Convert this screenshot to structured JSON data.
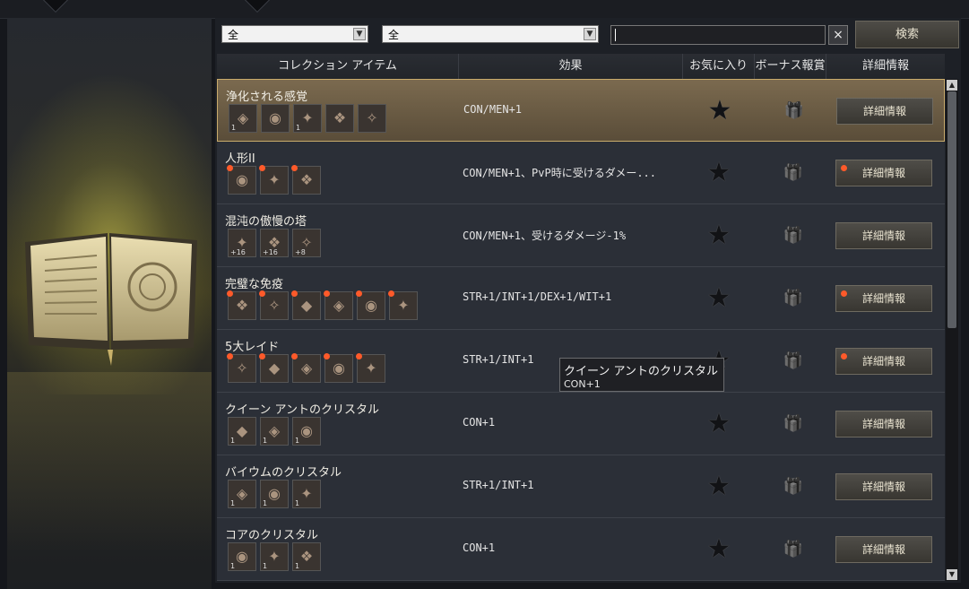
{
  "filters": {
    "filter1_value": "全",
    "filter2_value": "全",
    "search_value": "",
    "clear_symbol": "×",
    "search_button_label": "検索"
  },
  "table": {
    "headers": {
      "item": "コレクション アイテム",
      "effect": "効果",
      "favorite": "お気に入り",
      "bonus": "ボーナス報賞",
      "details": "詳細情報"
    },
    "rows": [
      {
        "name": "浄化される感覚",
        "effect": "CON/MEN+1",
        "detail_label": "詳細情報",
        "selected": true,
        "detail_alert": false,
        "items": [
          {
            "count": "1",
            "alert": false
          },
          {
            "count": "",
            "alert": false
          },
          {
            "count": "1",
            "alert": false
          },
          {
            "count": "",
            "alert": false
          },
          {
            "count": "",
            "alert": false
          }
        ]
      },
      {
        "name": "人形II",
        "effect": "CON/MEN+1、PvP時に受けるダメー...",
        "detail_label": "詳細情報",
        "selected": false,
        "detail_alert": true,
        "items": [
          {
            "count": "",
            "alert": true
          },
          {
            "count": "",
            "alert": true
          },
          {
            "count": "",
            "alert": true
          }
        ]
      },
      {
        "name": "混沌の傲慢の塔",
        "effect": "CON/MEN+1、受けるダメージ-1%",
        "detail_label": "詳細情報",
        "selected": false,
        "detail_alert": false,
        "items": [
          {
            "count": "+16",
            "alert": false
          },
          {
            "count": "+16",
            "alert": false
          },
          {
            "count": "+8",
            "alert": false
          }
        ]
      },
      {
        "name": "完璧な免疫",
        "effect": "STR+1/INT+1/DEX+1/WIT+1",
        "detail_label": "詳細情報",
        "selected": false,
        "detail_alert": true,
        "items": [
          {
            "count": "",
            "alert": true
          },
          {
            "count": "",
            "alert": true
          },
          {
            "count": "",
            "alert": true
          },
          {
            "count": "",
            "alert": true
          },
          {
            "count": "",
            "alert": true
          },
          {
            "count": "",
            "alert": true
          }
        ]
      },
      {
        "name": "5大レイド",
        "effect": "STR+1/INT+1",
        "detail_label": "詳細情報",
        "selected": false,
        "detail_alert": true,
        "items": [
          {
            "count": "",
            "alert": true
          },
          {
            "count": "",
            "alert": true
          },
          {
            "count": "",
            "alert": true
          },
          {
            "count": "",
            "alert": true
          },
          {
            "count": "",
            "alert": true
          }
        ]
      },
      {
        "name": "クイーン アントのクリスタル",
        "effect": "CON+1",
        "detail_label": "詳細情報",
        "selected": false,
        "detail_alert": false,
        "items": [
          {
            "count": "1",
            "alert": false
          },
          {
            "count": "1",
            "alert": false
          },
          {
            "count": "1",
            "alert": false
          }
        ]
      },
      {
        "name": "バイウムのクリスタル",
        "effect": "STR+1/INT+1",
        "detail_label": "詳細情報",
        "selected": false,
        "detail_alert": false,
        "items": [
          {
            "count": "1",
            "alert": false
          },
          {
            "count": "1",
            "alert": false
          },
          {
            "count": "1",
            "alert": false
          }
        ]
      },
      {
        "name": "コアのクリスタル",
        "effect": "CON+1",
        "detail_label": "詳細情報",
        "selected": false,
        "detail_alert": false,
        "items": [
          {
            "count": "1",
            "alert": false
          },
          {
            "count": "1",
            "alert": false
          },
          {
            "count": "1",
            "alert": false
          }
        ]
      }
    ]
  },
  "tooltip": {
    "title": "クイーン アントのクリスタル",
    "effect": "CON+1"
  },
  "icons": {
    "favorite": "star-icon",
    "bonus": "gift-check-icon",
    "scroll_up": "arrow-up-icon",
    "scroll_down": "arrow-down-icon"
  },
  "colors": {
    "alert_dot": "#ff5a2a",
    "selected_row_border": "#c9ab6c"
  }
}
